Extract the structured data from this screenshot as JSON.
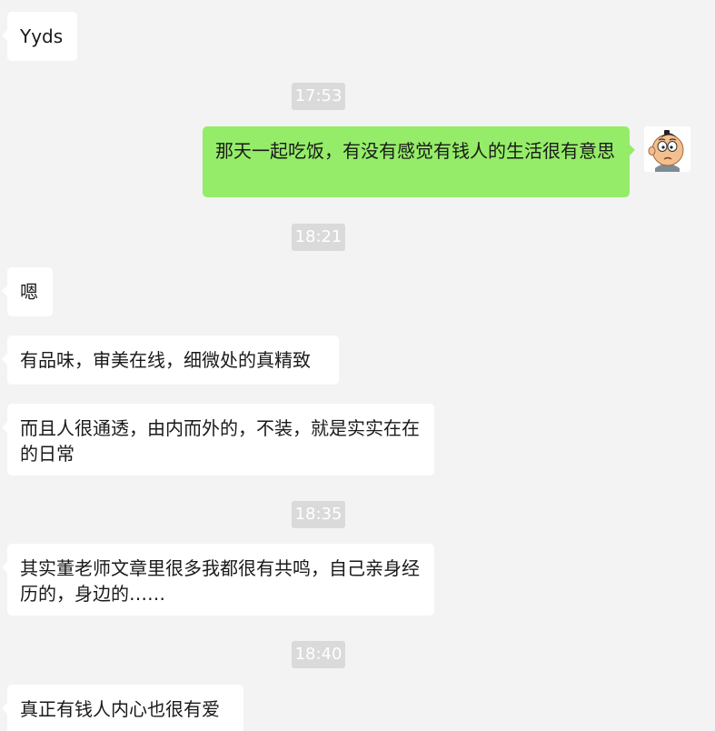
{
  "messages": [
    {
      "id": "m1",
      "side": "in",
      "text": "Yyds"
    },
    {
      "id": "t1",
      "type": "time",
      "text": "17:53"
    },
    {
      "id": "m2",
      "side": "out",
      "text": "那天一起吃饭，有没有感觉有钱人的生活很有意思"
    },
    {
      "id": "t2",
      "type": "time",
      "text": "18:21"
    },
    {
      "id": "m3",
      "side": "in",
      "text": "嗯"
    },
    {
      "id": "m4",
      "side": "in",
      "text": "有品味，审美在线，细微处的真精致"
    },
    {
      "id": "m5",
      "side": "in",
      "text": "而且人很通透，由内而外的，不装，就是实实在在的日常"
    },
    {
      "id": "t3",
      "type": "time",
      "text": "18:35"
    },
    {
      "id": "m6",
      "side": "in",
      "text": "其实董老师文章里很多我都很有共鸣，自己亲身经历的，身边的……"
    },
    {
      "id": "t4",
      "type": "time",
      "text": "18:40"
    },
    {
      "id": "m7",
      "side": "in",
      "text": "真正有钱人内心也很有爱"
    }
  ],
  "avatar": {
    "icon": "cartoon-boy-avatar-icon"
  },
  "colors": {
    "background": "#f3f3f3",
    "incoming_bubble": "#ffffff",
    "outgoing_bubble": "#95ec69",
    "timestamp_bg": "#dadada"
  }
}
